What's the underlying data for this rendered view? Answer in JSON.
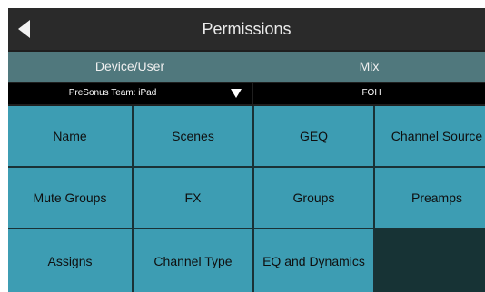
{
  "window": {
    "title": "Permissions"
  },
  "nav": {
    "back_icon": "back-arrow-icon"
  },
  "columns": {
    "left": "Device/User",
    "right": "Mix"
  },
  "dropdowns": {
    "device": {
      "value": "PreSonus Team: iPad"
    },
    "mix": {
      "value": "FOH"
    }
  },
  "tiles": [
    "Name",
    "Scenes",
    "GEQ",
    "Channel Source",
    "Mute Groups",
    "FX",
    "Groups",
    "Preamps",
    "Assigns",
    "Channel Type",
    "EQ and Dynamics",
    ""
  ],
  "colors": {
    "tile": "#3d9db3",
    "header": "#50787d",
    "empty_tile": "#173335"
  }
}
